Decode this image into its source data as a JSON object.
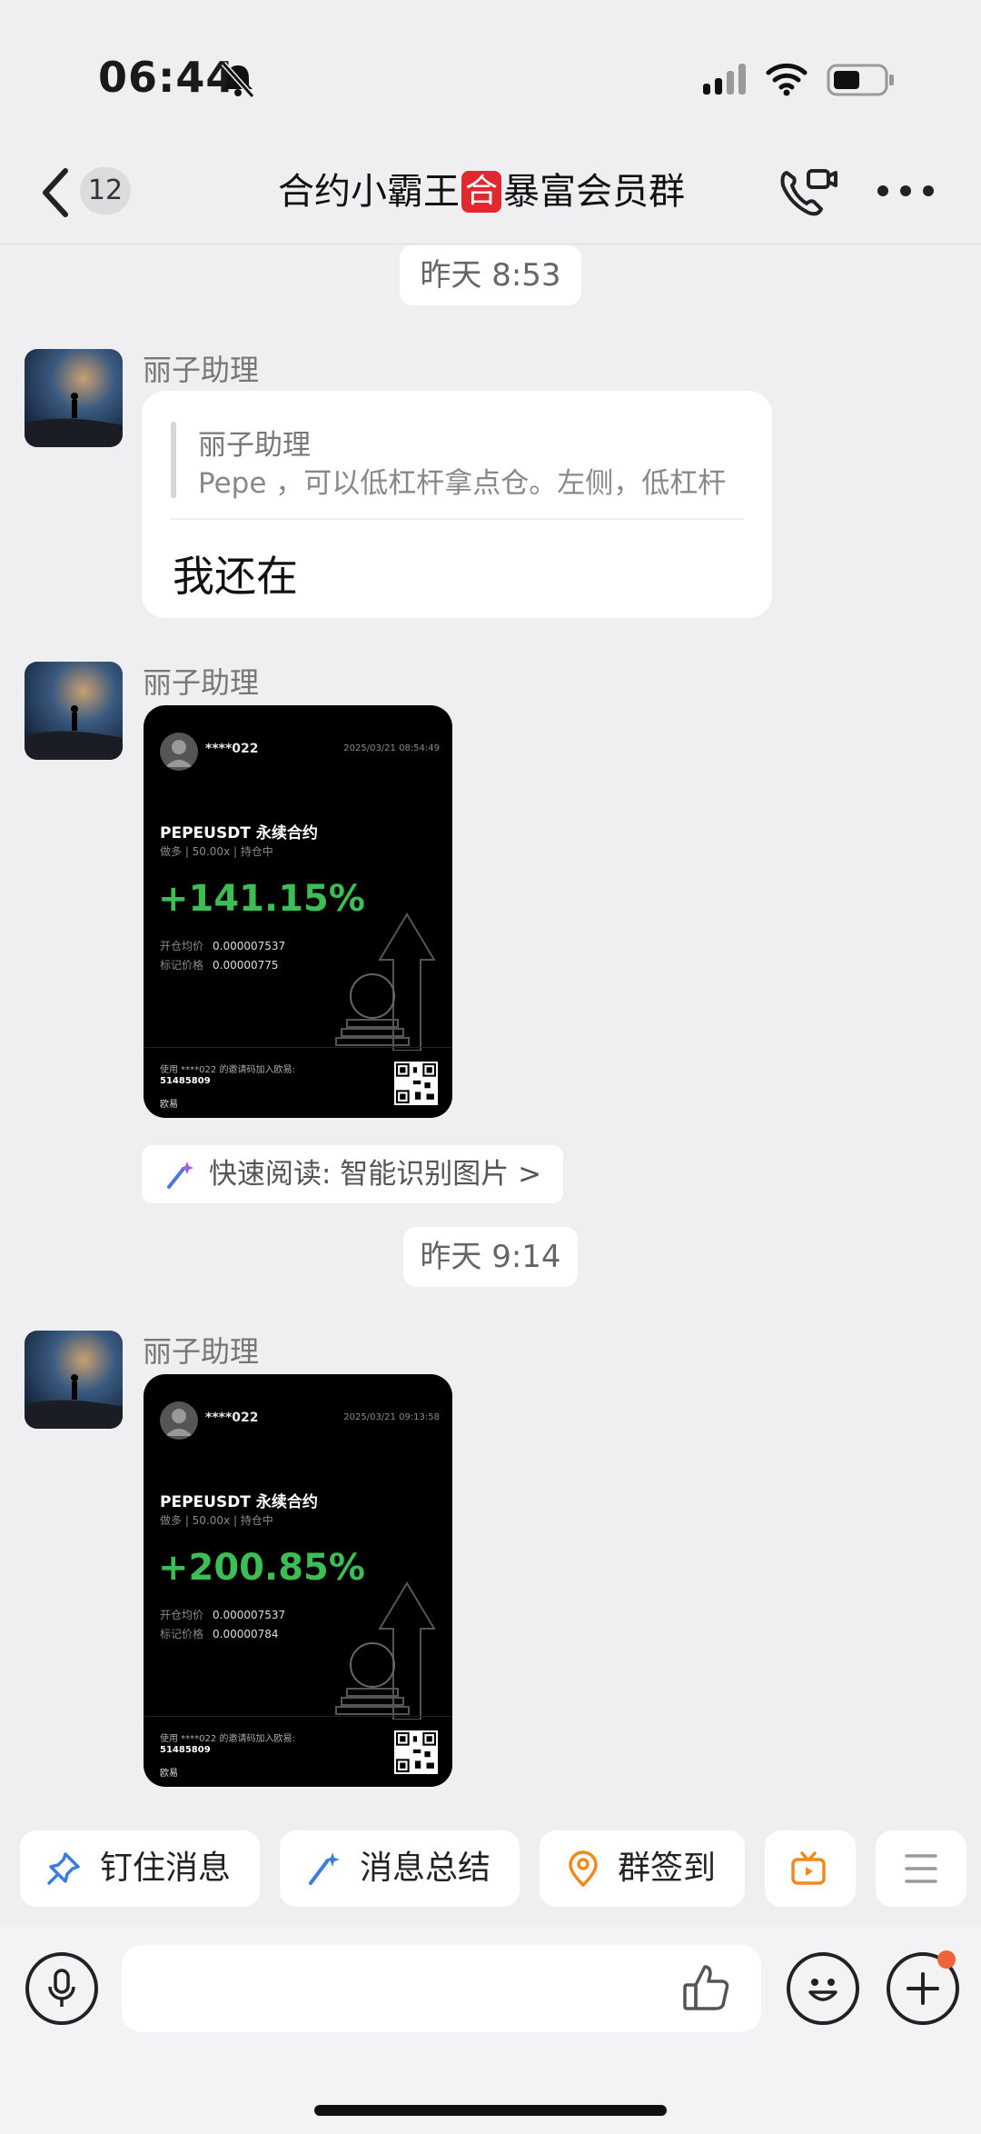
{
  "status_bar": {
    "time": "06:44"
  },
  "header": {
    "back_count": "12",
    "title_prefix": "合约小霸王",
    "title_badge": "合",
    "title_suffix": "暴富会员群"
  },
  "messages": [
    {
      "time": "昨天 8:53",
      "sender": "丽子助理",
      "quote_sender": "丽子助理",
      "quote_text": "Pepe ，可以低杠杆拿点仓。左侧，低杠杆",
      "text": "我还在"
    },
    {
      "sender": "丽子助理"
    },
    {
      "time": "昨天 9:14",
      "sender": "丽子助理"
    }
  ],
  "cards": [
    {
      "user": "****022",
      "date": "2025/03/21 08:54:49",
      "pair": "PEPEUSDT 永续合约",
      "meta": "做多 | 50.00x | 持仓中",
      "pct": "+141.15%",
      "open_label": "开仓均价",
      "open_value": "0.000007537",
      "mark_label": "标记价格",
      "mark_value": "0.00000775",
      "invite": "使用 ****022 的邀请码加入欧易:",
      "code": "51485809",
      "brand": "欧易"
    },
    {
      "user": "****022",
      "date": "2025/03/21 09:13:58",
      "pair": "PEPEUSDT 永续合约",
      "meta": "做多 | 50.00x | 持仓中",
      "pct": "+200.85%",
      "open_label": "开仓均价",
      "open_value": "0.000007537",
      "mark_label": "标记价格",
      "mark_value": "0.00000784",
      "invite": "使用 ****022 的邀请码加入欧易:",
      "code": "51485809",
      "brand": "欧易"
    }
  ],
  "quick_read": "快速阅读: 智能识别图片 >",
  "actions": [
    {
      "label": "钉住消息",
      "icon": "pin-icon"
    },
    {
      "label": "消息总结",
      "icon": "sparkle-icon"
    },
    {
      "label": "群签到",
      "icon": "location-icon"
    },
    {
      "label": "视频",
      "icon": "tv-icon"
    }
  ],
  "input": {
    "placeholder": ""
  },
  "colors": {
    "accent_green": "#3cbe55",
    "badge_red": "#e0282e",
    "notify_dot": "#f0633a"
  }
}
